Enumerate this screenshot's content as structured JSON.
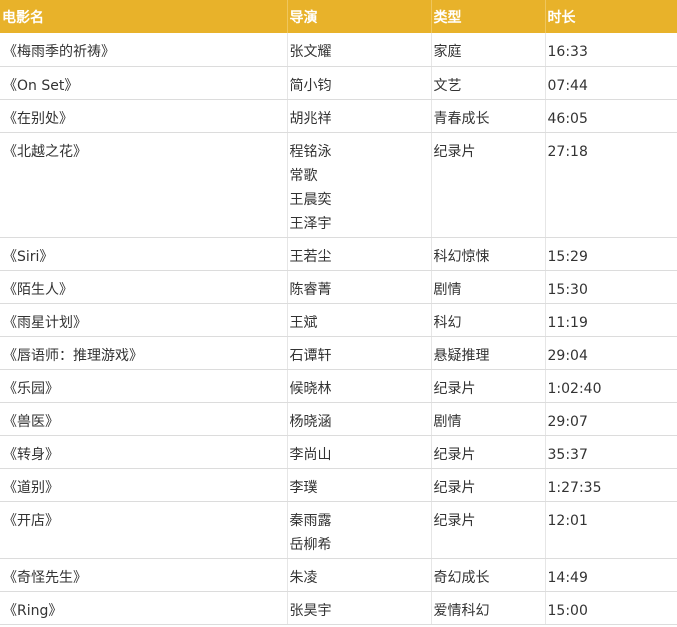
{
  "headers": [
    "电影名",
    "导演",
    "类型",
    "时长"
  ],
  "rows": [
    {
      "title": "《梅雨季的祈祷》",
      "directors": [
        "张文耀"
      ],
      "genre": "家庭",
      "duration": "16:33"
    },
    {
      "title": "《On Set》",
      "directors": [
        "简小钧"
      ],
      "genre": "文艺",
      "duration": "07:44"
    },
    {
      "title": "《在别处》",
      "directors": [
        "胡兆祥"
      ],
      "genre": "青春成长",
      "duration": "46:05"
    },
    {
      "title": "《北越之花》",
      "directors": [
        "程铭泳",
        "常歌",
        "王晨奕",
        "王泽宇"
      ],
      "genre": "纪录片",
      "duration": "27:18"
    },
    {
      "title": "《Siri》",
      "directors": [
        "王若尘"
      ],
      "genre": "科幻惊悚",
      "duration": "15:29"
    },
    {
      "title": "《陌生人》",
      "directors": [
        "陈睿菁"
      ],
      "genre": "剧情",
      "duration": "15:30"
    },
    {
      "title": "《雨星计划》",
      "directors": [
        "王斌"
      ],
      "genre": "科幻",
      "duration": "11:19"
    },
    {
      "title": "《唇语师：推理游戏》",
      "directors": [
        "石谭轩"
      ],
      "genre": "悬疑推理",
      "duration": "29:04"
    },
    {
      "title": "《乐园》",
      "directors": [
        "候晓林"
      ],
      "genre": "纪录片",
      "duration": "1:02:40"
    },
    {
      "title": "《兽医》",
      "directors": [
        "杨晓涵"
      ],
      "genre": "剧情",
      "duration": "29:07"
    },
    {
      "title": "《转身》",
      "directors": [
        "李尚山"
      ],
      "genre": "纪录片",
      "duration": "35:37"
    },
    {
      "title": "《道别》",
      "directors": [
        "李璞"
      ],
      "genre": "纪录片",
      "duration": "1:27:35"
    },
    {
      "title": "《开店》",
      "directors": [
        "秦雨露",
        "岳柳希"
      ],
      "genre": "纪录片",
      "duration": "12:01"
    },
    {
      "title": "《奇怪先生》",
      "directors": [
        "朱凌"
      ],
      "genre": "奇幻成长",
      "duration": "14:49"
    },
    {
      "title": "《Ring》",
      "directors": [
        "张昊宇"
      ],
      "genre": "爱情科幻",
      "duration": "15:00"
    }
  ]
}
